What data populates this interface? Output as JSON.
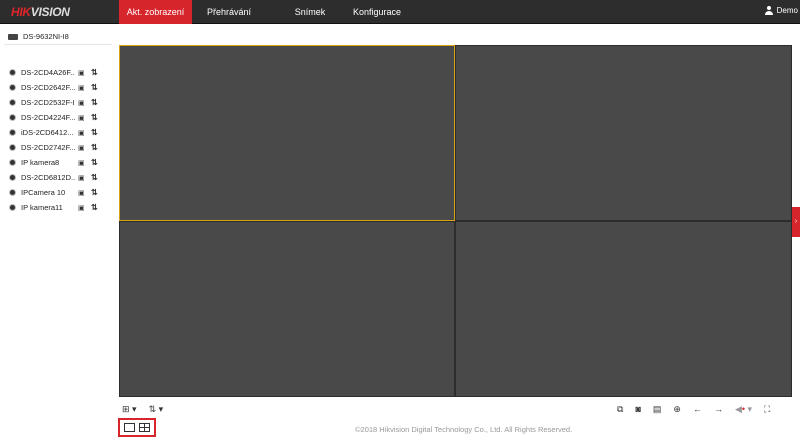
{
  "header": {
    "logo_red": "HIK",
    "logo_gray": "VISION",
    "tabs": [
      {
        "label": "Akt. zobrazení",
        "active": true
      },
      {
        "label": "Přehrávání"
      },
      {
        "label": "Snímek"
      },
      {
        "label": "Konfigurace"
      }
    ],
    "user": "Demo"
  },
  "sidebar": {
    "device": "DS-9632NI-I8",
    "cameras": [
      "DS-2CD4A26F...",
      "DS-2CD2642F...",
      "DS-2CD2532F-I",
      "DS-2CD4224F...",
      "iDS-2CD6412...",
      "DS-2CD2742F...",
      "IP kamera8",
      "DS-2CD6812D...",
      "IPCamera 10",
      "IP kamera11"
    ]
  },
  "toolbar": {
    "left": [
      "layout-icon",
      "stream-icon"
    ],
    "right": [
      "capture-all-icon",
      "snapshot-icon",
      "record-icon",
      "zoom-icon",
      "prev-icon",
      "next-icon",
      "audio-icon",
      "fullscreen-icon"
    ]
  },
  "footer": "©2018 Hikvision Digital Technology Co., Ltd. All Rights Reserved.",
  "colors": {
    "accent": "#d7252c",
    "selected": "#d7a317"
  }
}
